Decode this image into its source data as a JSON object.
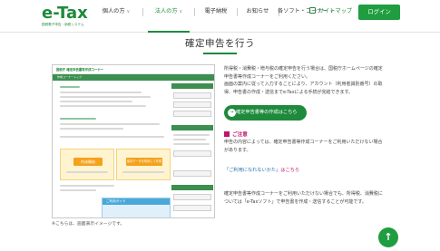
{
  "header": {
    "logo_text": "e-Tax",
    "logo_sub": "国税電子申告・納税システム",
    "nav": [
      {
        "label": "個人の方",
        "chevron": "∨",
        "active": false
      },
      {
        "label": "法人の方",
        "chevron": "∨",
        "active": true
      },
      {
        "label": "電子納税",
        "chevron": "",
        "active": false
      },
      {
        "label": "お知らせ",
        "chevron": "",
        "active": false
      },
      {
        "label": "各ソフト・コーナー",
        "chevron": "∨",
        "active": false
      }
    ],
    "sitemap_label": "サイトマップ",
    "login_label": "ログイン"
  },
  "page": {
    "title": "確定申告を行う"
  },
  "screenshot": {
    "mini_logo": "国税庁 確定申告書等作成コーナー",
    "bar_label": "作成コーナートップ",
    "yellow_label_1": "作成開始",
    "yellow_label_2": "保存データを利用して作成",
    "blue_head": "ご利用ガイド",
    "caption": "※こちらは、画面表示イメージです。"
  },
  "content": {
    "intro_lines": [
      "所得税・消費税・贈与税の確定申告を行う場合は、国税庁ホームページの確定",
      "申告書等作成コーナーをご利用ください。",
      "画面の案内に従って入力することにより、アカウント（利用者識別番号）の取",
      "得、申告書の作成・送信までe-Taxによる手続が完結できます。"
    ],
    "cta_label": "確定申告書等の作成はこちら",
    "cta_arrow": "→",
    "notice_title": "ご注意",
    "notice_lines": [
      "申告の内容によっては、確定申告書等作成コーナーをご利用いただけない場合",
      "があります。"
    ],
    "faq_prefix": "「ご利用になれないかた」はこちら",
    "faq_link_label": "「ご利用になれないかた」",
    "faq_suffix": "はこちら",
    "bottom_lines": [
      "確定申告書等作成コーナーをご利用いただけない場合でも、所得税、消費税に",
      "ついては「e-Taxソフト」で申告書を作成・送信することが可能です。"
    ]
  },
  "scroll_top": {
    "icon": "arrow-up-icon",
    "glyph": "↑"
  },
  "colors": {
    "brand_green": "#1f8a3c",
    "button_green": "#1f9d40",
    "notice_pink": "#c0156a"
  }
}
